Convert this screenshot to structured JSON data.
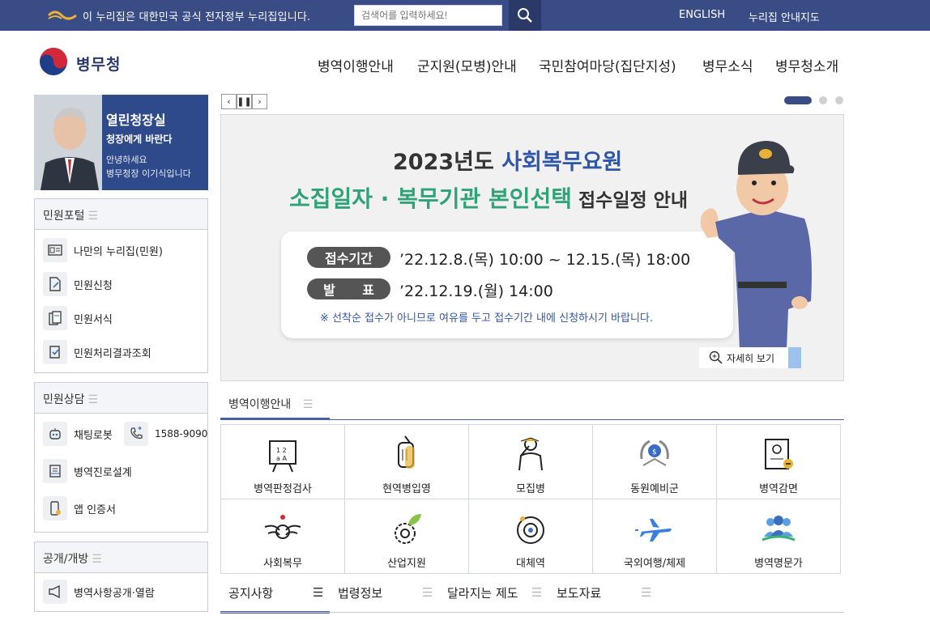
{
  "topbar": {
    "gov_notice": "이 누리집은 대한민국 공식 전자정부 누리집입니다.",
    "search_placeholder": "검색어를 입력하세요!",
    "links": [
      "ENGLISH",
      "누리집 안내지도"
    ]
  },
  "header": {
    "logo_text": "병무청",
    "nav": [
      "병역이행안내",
      "군지원(모병)안내",
      "국민참여마당(집단지성)",
      "병무소식",
      "병무청소개"
    ]
  },
  "commissioner": {
    "title": "열린청장실",
    "subtitle": "청장에게 바란다",
    "greeting_1": "안녕하세요",
    "greeting_2": "병무청장 이기식입니다"
  },
  "civil_portal": {
    "title": "민원포털",
    "items": [
      "나만의 누리집(민원)",
      "민원신청",
      "민원서식",
      "민원처리결과조회"
    ]
  },
  "consult": {
    "title": "민원상담",
    "chatbot": "채팅로봇",
    "phone": "1588-9090",
    "career": "병역진로설계",
    "app_cert": "앱 인증서"
  },
  "open": {
    "title": "공개/개방",
    "items": [
      "병역사항공개·열람"
    ]
  },
  "banner": {
    "title_prefix": "2023년도 ",
    "title_highlight": "사회복무요원",
    "subtitle_green": "소집일자 · 복무기관 본인선택",
    "subtitle_dark": " 접수일정 안내",
    "label_period": "접수기간",
    "period": "’22.12.8.(목) 10:00 ~ 12.15.(목) 18:00",
    "label_announce": "발      표",
    "announce": "’22.12.19.(월) 14:00",
    "note": "※ 선착순 접수가 아니므로 여유를 두고 접수기간 내에 신청하시기 바랍니다.",
    "more": "자세히 보기"
  },
  "services": {
    "tab": "병역이행안내",
    "items": [
      "병역판정검사",
      "현역병입영",
      "모집병",
      "동원예비군",
      "병역감면",
      "사회복무",
      "산업지원",
      "대체역",
      "국외여행/체제",
      "병역명문가"
    ]
  },
  "notice_tabs": [
    "공지사항",
    "법령정보",
    "달라지는 제도",
    "보도자료"
  ],
  "colors": {
    "topbar": "#3a4c86",
    "accent": "#4a5fa0",
    "banner_blue": "#2f56a8",
    "banner_green": "#2fa27a"
  }
}
